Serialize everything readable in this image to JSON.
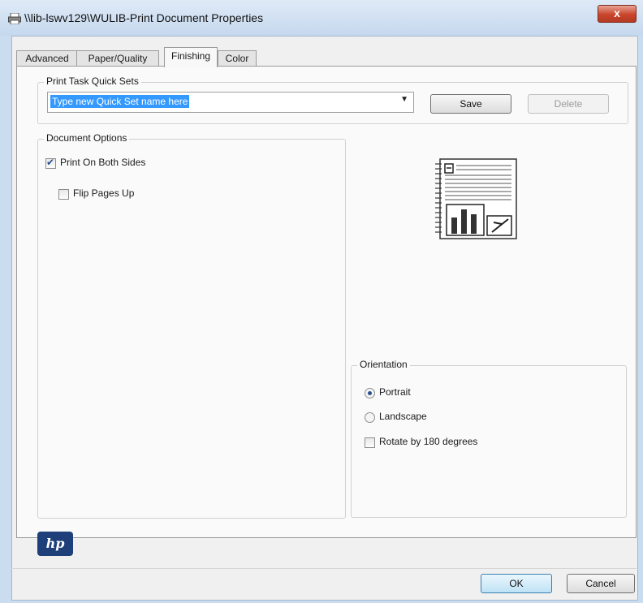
{
  "window": {
    "title": "\\\\lib-lswv129\\WULIB-Print Document Properties",
    "close_label": "x"
  },
  "tabs": [
    {
      "label": "Advanced",
      "active": false
    },
    {
      "label": "Paper/Quality",
      "active": false
    },
    {
      "label": "Finishing",
      "active": true
    },
    {
      "label": "Color",
      "active": false
    }
  ],
  "quick_sets": {
    "group_label": "Print Task Quick Sets",
    "combo_value": "Type new Quick Set name here",
    "save_label": "Save",
    "delete_label": "Delete"
  },
  "document_options": {
    "group_label": "Document Options",
    "print_both_sides": {
      "label": "Print On Both Sides",
      "checked": true
    },
    "flip_pages_up": {
      "label": "Flip Pages Up",
      "checked": false
    }
  },
  "orientation": {
    "group_label": "Orientation",
    "portrait": {
      "label": "Portrait",
      "selected": true
    },
    "landscape": {
      "label": "Landscape",
      "selected": false
    },
    "rotate_180": {
      "label": "Rotate by 180 degrees",
      "checked": false
    }
  },
  "brand": {
    "logo_text": "hp"
  },
  "footer": {
    "ok_label": "OK",
    "cancel_label": "Cancel"
  },
  "colors": {
    "selection": "#3399ff",
    "title_close": "#c9452c",
    "hp_blue": "#1f3f7a"
  }
}
